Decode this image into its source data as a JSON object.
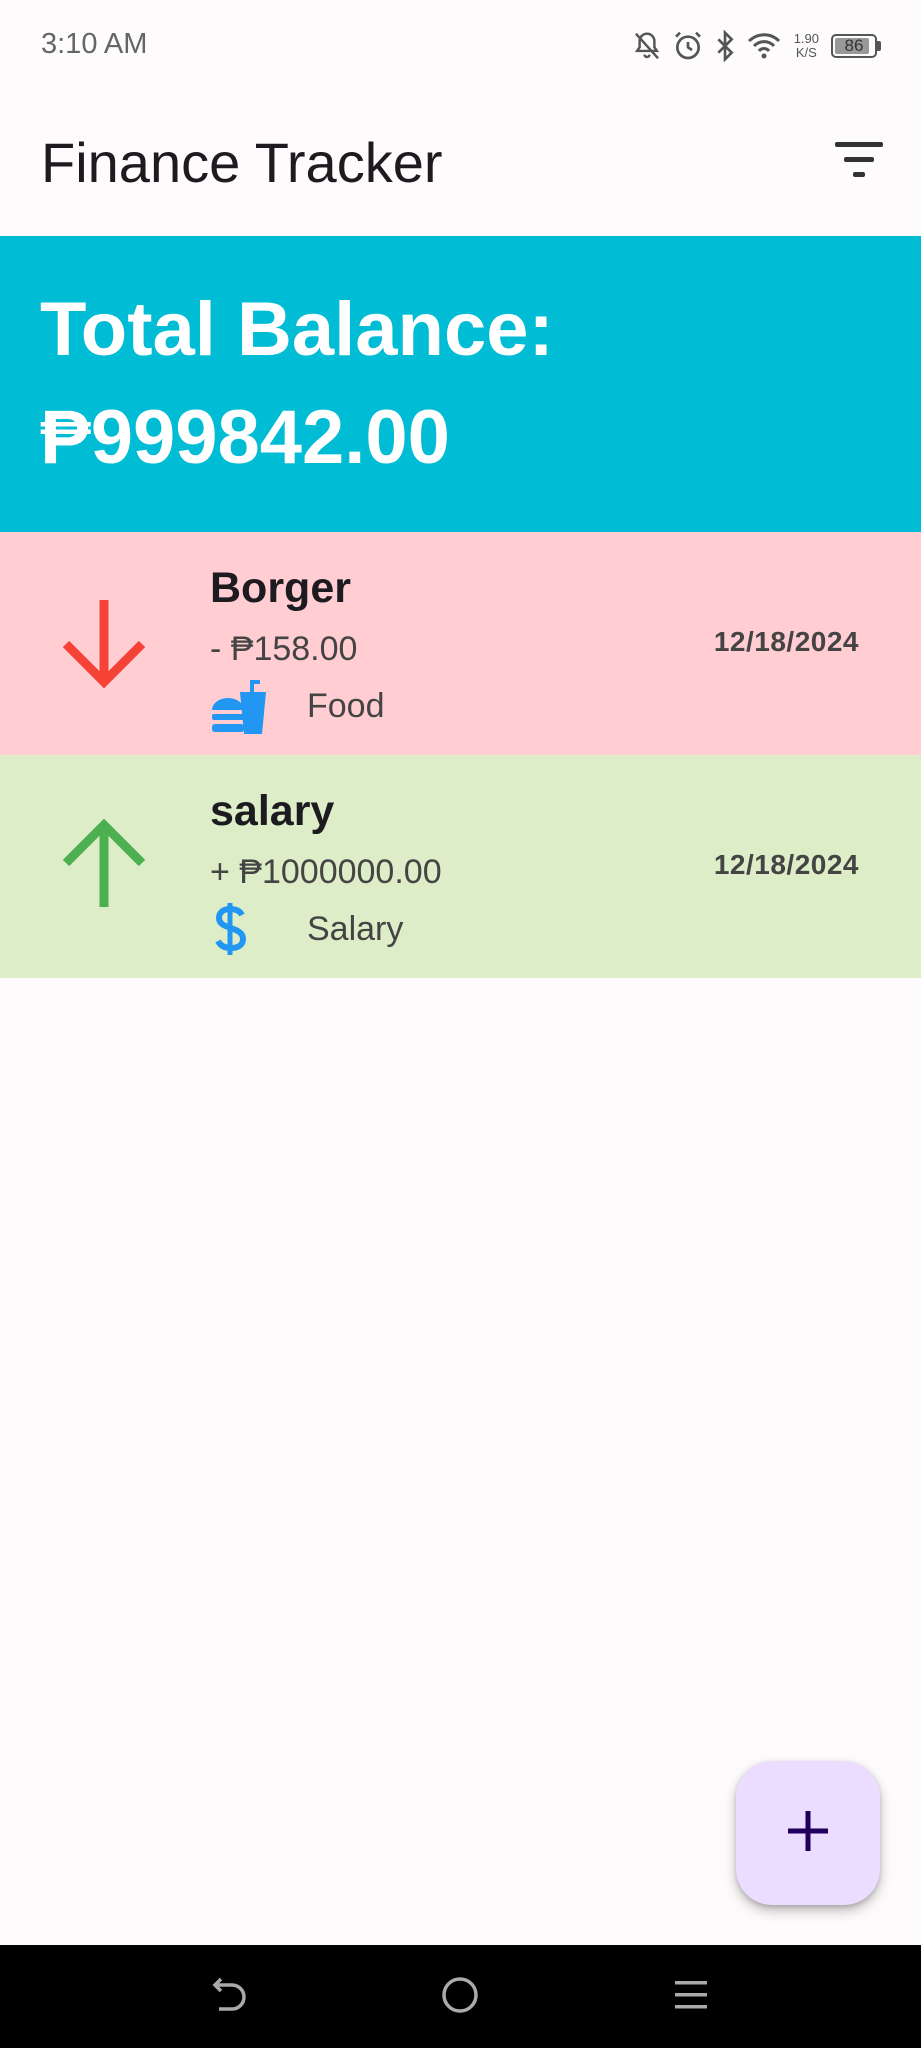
{
  "status_bar": {
    "time": "3:10 AM",
    "net_speed_value": "1.90",
    "net_speed_unit": "K/S",
    "battery_level": "86",
    "icons": [
      "mute-bell-icon",
      "alarm-icon",
      "bluetooth-icon",
      "wifi-icon",
      "battery-icon"
    ]
  },
  "app_bar": {
    "title": "Finance Tracker",
    "filter_icon": "filter-list-icon"
  },
  "balance": {
    "label": "Total Balance:",
    "value": "₱999842.00"
  },
  "transactions": [
    {
      "title": "Borger",
      "amount": "- ₱158.00",
      "category": "Food",
      "category_icon": "fastfood-icon",
      "date": "12/18/2024",
      "type": "expense",
      "arrow_icon": "arrow-down-icon",
      "color": "#ffcdd2",
      "arrow_color": "#f44336"
    },
    {
      "title": "salary",
      "amount": "+ ₱1000000.00",
      "category": "Salary",
      "category_icon": "dollar-icon",
      "date": "12/18/2024",
      "type": "income",
      "arrow_icon": "arrow-up-icon",
      "color": "#dcedc8",
      "arrow_color": "#4caf50"
    }
  ],
  "fab": {
    "icon": "add-icon"
  },
  "nav_bar": {
    "icons": [
      "back-icon",
      "home-icon",
      "recents-icon"
    ]
  },
  "colors": {
    "accent": "#00bcd4",
    "category_icon": "#2196f3",
    "fab_bg": "#eaddff"
  }
}
